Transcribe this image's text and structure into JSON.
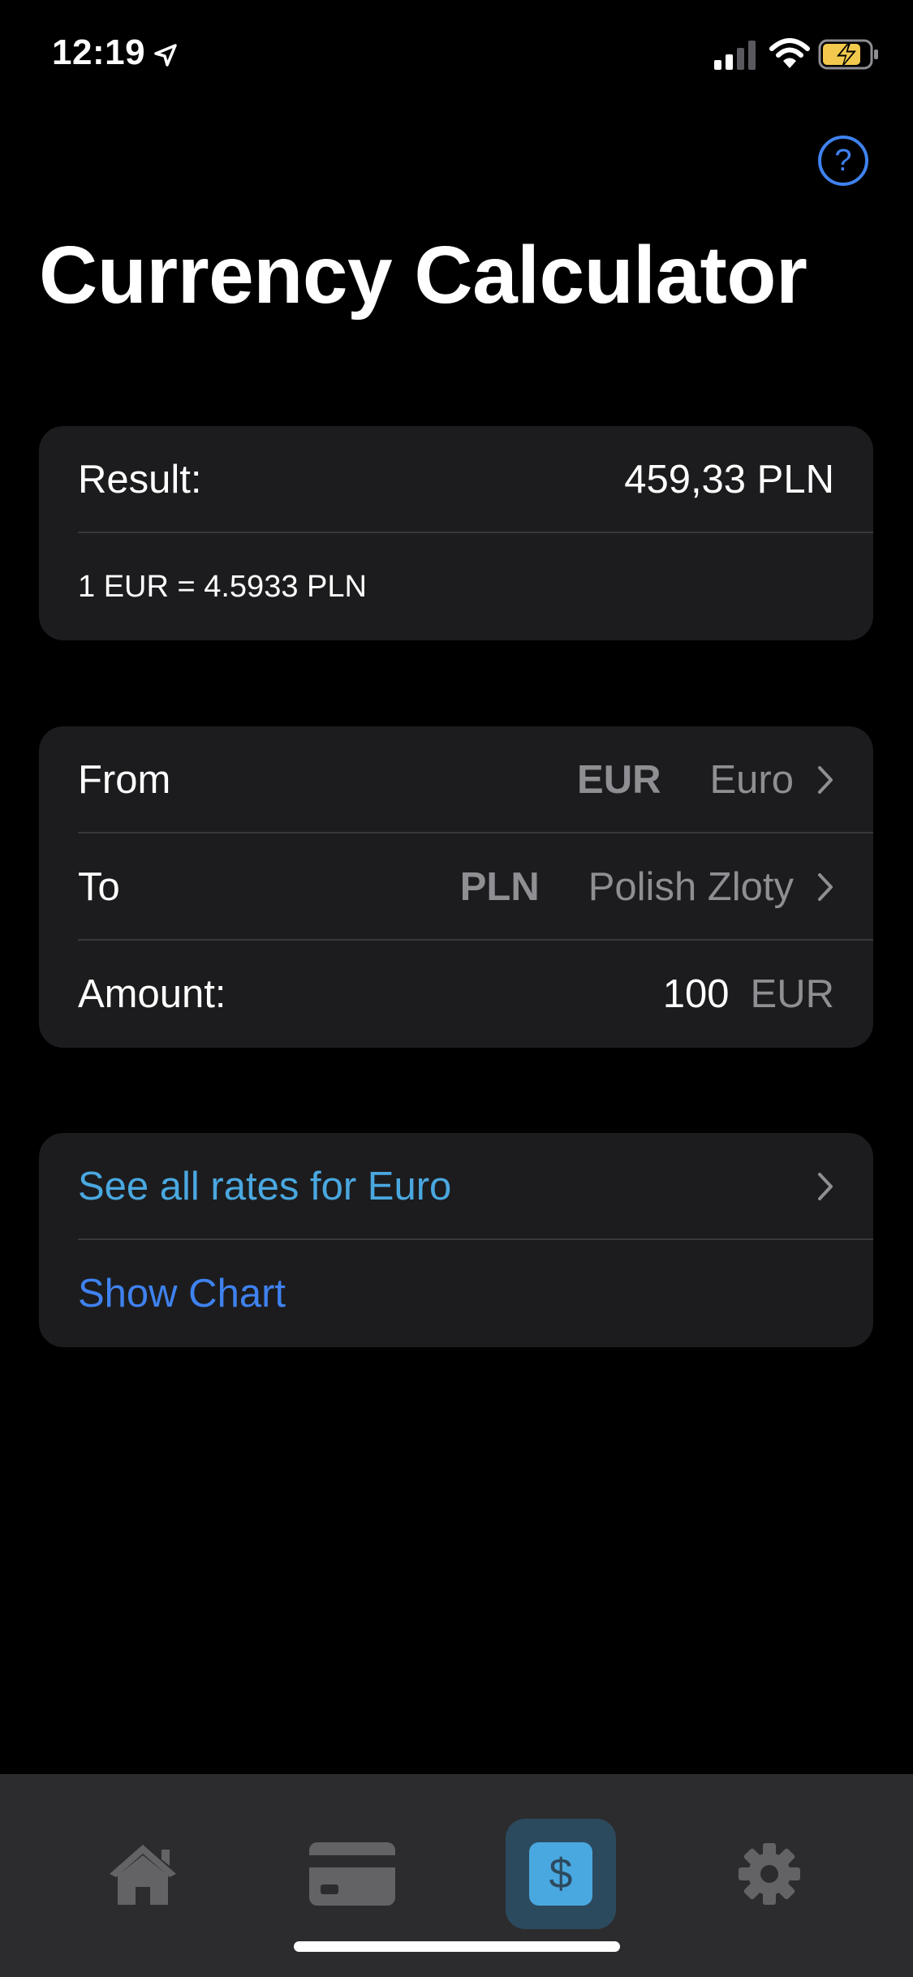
{
  "status_bar": {
    "time": "12:19",
    "icons": [
      "location-arrow-icon",
      "cellular-signal-icon",
      "wifi-icon",
      "battery-charging-icon"
    ]
  },
  "help_button": {
    "label": "?"
  },
  "page_title": "Currency Calculator",
  "result_card": {
    "result_label": "Result:",
    "result_value": "459,33 PLN",
    "rate_text": "1 EUR = 4.5933 PLN"
  },
  "conversion_card": {
    "from_label": "From",
    "from_code": "EUR",
    "from_name": "Euro",
    "to_label": "To",
    "to_code": "PLN",
    "to_name": "Polish Zloty",
    "amount_label": "Amount:",
    "amount_value": "100",
    "amount_currency": "EUR"
  },
  "links_card": {
    "see_all_rates": "See all rates for Euro",
    "show_chart": "Show Chart"
  },
  "tab_bar": {
    "tabs": [
      {
        "icon": "home-icon",
        "active": false
      },
      {
        "icon": "credit-card-icon",
        "active": false
      },
      {
        "icon": "dollar-icon",
        "active": true
      },
      {
        "icon": "gear-icon",
        "active": false
      }
    ]
  },
  "colors": {
    "accent_blue": "#3f82f0",
    "link_cyan": "#4aa8e0",
    "card_bg": "#1c1c1e",
    "tab_active_bg": "#2c4a5e",
    "battery_yellow": "#f2c94c"
  }
}
